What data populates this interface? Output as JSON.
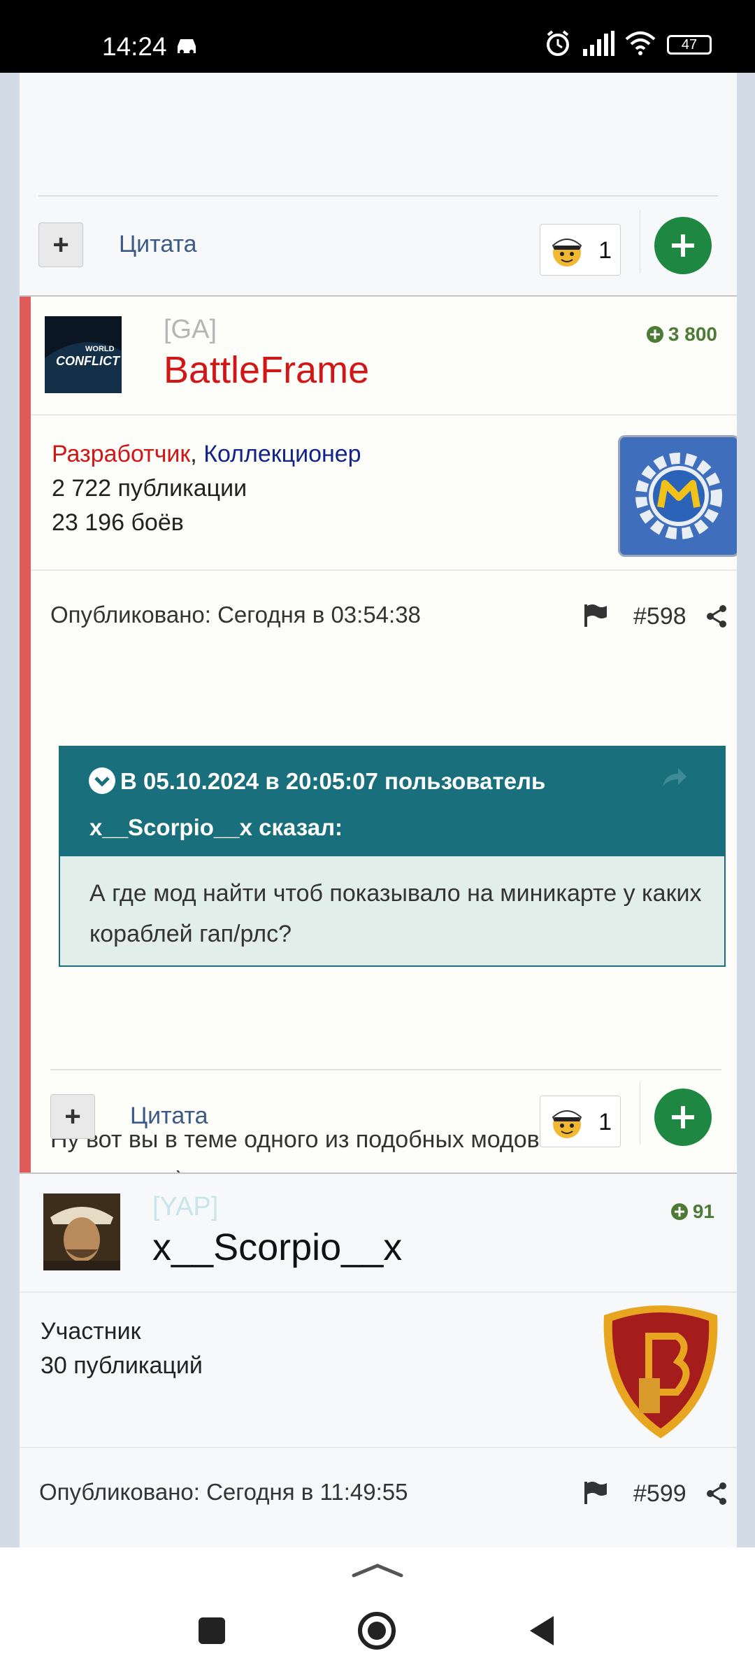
{
  "status_bar": {
    "time": "14:24",
    "battery": "47"
  },
  "post_prev": {
    "quote_label": "Цитата",
    "reaction_count": "1"
  },
  "post_598": {
    "clan": "[GA]",
    "username": "BattleFrame",
    "username_color": "#d01616",
    "reputation": "3 800",
    "avatar_text": [
      "WORLD",
      "CONFLICT"
    ],
    "role1": "Разработчик",
    "role_sep": ", ",
    "role2": "Коллекционер",
    "publications": "2 722 публикации",
    "battles": "23 196 боёв",
    "published": "Опубликовано: Сегодня в 03:54:38",
    "number": "#598",
    "quote_header_1": "В 05.10.2024 в 20:05:07 пользователь",
    "quote_header_2": "x__Scorpio__x сказал:",
    "quote_text": "А где мод найти чтоб показывало на миникарте у каких кораблей гап/рлс?",
    "body": "Ну вот вы в теме одного из подобных модов и находитесь)",
    "quote_label": "Цитата",
    "reaction_count": "1"
  },
  "post_599": {
    "clan": "[YAP]",
    "username": "x__Scorpio__x",
    "reputation": "91",
    "role": "Участник",
    "publications": "30 публикаций",
    "published": "Опубликовано: Сегодня в 11:49:55",
    "number": "#599"
  },
  "colors": {
    "accent_green": "#1e8741",
    "quote_teal": "#196f7c",
    "highlight_border": "#e05a5a",
    "rep_green": "#4d7b35"
  }
}
